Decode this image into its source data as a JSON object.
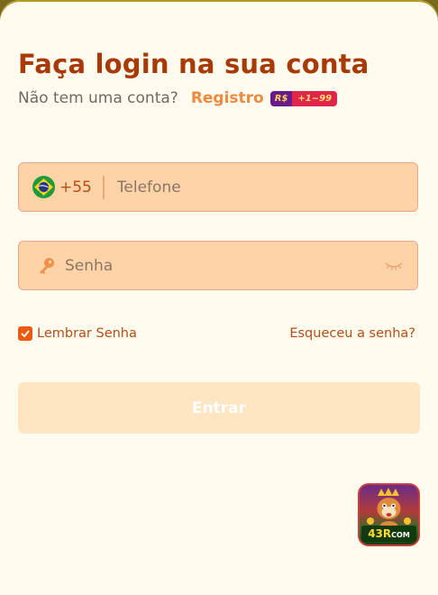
{
  "header": {
    "title": "Faça login na sua conta",
    "subtitle": "Não tem uma conta?",
    "register_link": "Registro",
    "promo_currency": "R$",
    "promo_range": "+1~99"
  },
  "phone": {
    "country_code": "+55",
    "placeholder": "Telefone",
    "flag_icon": "brazil-flag-icon"
  },
  "password": {
    "placeholder": "Senha",
    "key_icon": "key-icon",
    "toggle_icon": "eye-closed-icon"
  },
  "options": {
    "remember_label": "Lembrar Senha",
    "remember_checked": true,
    "forgot_link": "Esqueceu a senha?"
  },
  "submit": {
    "label": "Entrar"
  },
  "logo": {
    "text_main": "43R",
    "text_small": "COM"
  },
  "colors": {
    "title": "#a83a08",
    "accent": "#ef8a3f",
    "field_bg": "#ffd3a8",
    "button_bg": "#ffe6c2",
    "background": "#fffbef"
  }
}
